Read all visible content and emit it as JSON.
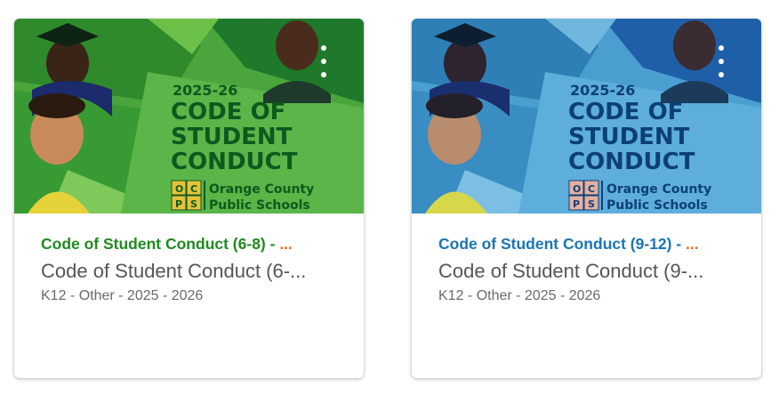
{
  "cards": [
    {
      "banner": {
        "year": "2025-26",
        "line1": "CODE OF",
        "line2": "STUDENT",
        "line3": "CONDUCT",
        "logo_letters": [
          "O",
          "C",
          "P",
          "S"
        ],
        "logo_line1": "Orange County",
        "logo_line2": "Public Schools",
        "theme": "green",
        "bg": "#4aa63c",
        "text_color": "#0b5a1e"
      },
      "title": "Code of Student Conduct (6-8) - ",
      "title_ellipsis": "...",
      "title_color": "#1f8a1f",
      "subtitle": "Code of Student Conduct (6-...",
      "meta": "K12 - Other - 2025 - 2026"
    },
    {
      "banner": {
        "year": "2025-26",
        "line1": "CODE OF",
        "line2": "STUDENT",
        "line3": "CONDUCT",
        "logo_letters": [
          "O",
          "C",
          "P",
          "S"
        ],
        "logo_line1": "Orange County",
        "logo_line2": "Public Schools",
        "theme": "blue",
        "bg": "#4a9fd0",
        "text_color": "#0c3f78"
      },
      "title": "Code of Student Conduct (9-12) - ",
      "title_ellipsis": "...",
      "title_color": "#1a75b5",
      "subtitle": "Code of Student Conduct (9-...",
      "meta": "K12 - Other - 2025 - 2026"
    }
  ],
  "icons": {
    "menu": "vertical-ellipsis-icon"
  }
}
